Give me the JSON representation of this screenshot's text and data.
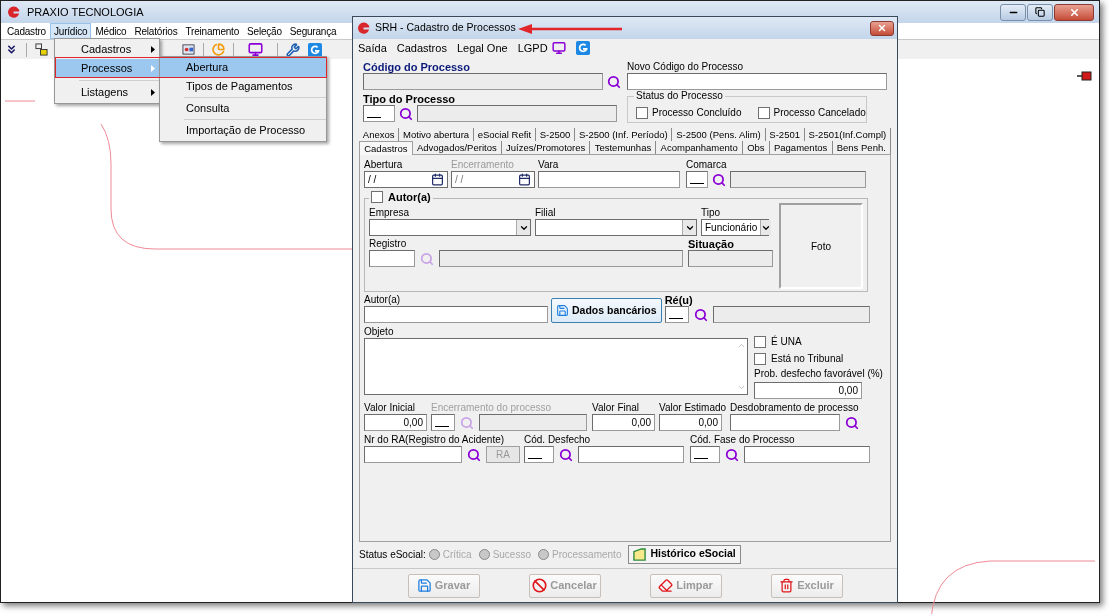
{
  "main_window": {
    "title": "PRAXIO TECNOLOGIA",
    "menu": [
      {
        "label": "Cadastro",
        "selected": false
      },
      {
        "label": "Jurídico",
        "selected": true
      },
      {
        "label": "Médico",
        "selected": false
      },
      {
        "label": "Relatórios",
        "selected": false
      },
      {
        "label": "Treinamento",
        "selected": false
      },
      {
        "label": "Seleção",
        "selected": false
      },
      {
        "label": "Segurança",
        "selected": false
      }
    ]
  },
  "dropdown_menu": {
    "items": [
      {
        "label": "Cadastros",
        "selected": false
      },
      {
        "label": "Processos",
        "selected": true
      },
      {
        "label": "Listagens",
        "selected": false
      }
    ]
  },
  "submenu": {
    "items": [
      {
        "label": "Abertura",
        "selected": true
      },
      {
        "label": "Tipos de Pagamentos",
        "selected": false
      },
      {
        "label": "Consulta",
        "selected": false
      },
      {
        "label": "Importação de Processo",
        "selected": false
      }
    ]
  },
  "dialog": {
    "title": "SRH - Cadastro de Processos",
    "menu": [
      "Saída",
      "Cadastros",
      "Legal One",
      "LGPD"
    ],
    "codigo_processo": {
      "label": "Código do Processo"
    },
    "novo_codigo": {
      "label": "Novo Código do Processo"
    },
    "tipo_processo": {
      "label": "Tipo do Processo"
    },
    "status_processo": {
      "label": "Status do Processo",
      "options": [
        {
          "label": "Processo Concluído",
          "checked": false
        },
        {
          "label": "Processo Cancelado",
          "checked": false
        }
      ]
    },
    "tabs_row_1": [
      {
        "label": "Anexos",
        "selected": false
      },
      {
        "label": "Motivo abertura",
        "selected": false
      },
      {
        "label": "eSocial Refit",
        "selected": false
      },
      {
        "label": "S-2500",
        "selected": false
      },
      {
        "label": "S-2500 (Inf. Período)",
        "selected": false
      },
      {
        "label": "S-2500 (Pens. Alim)",
        "selected": false
      },
      {
        "label": "S-2501",
        "selected": false
      },
      {
        "label": "S-2501(Inf.Compl)",
        "selected": false
      }
    ],
    "tabs_row_2": [
      {
        "label": "Cadastros",
        "selected": true
      },
      {
        "label": "Advogados/Peritos",
        "selected": false
      },
      {
        "label": "Juízes/Promotores",
        "selected": false
      },
      {
        "label": "Testemunhas",
        "selected": false
      },
      {
        "label": "Acompanhamento",
        "selected": false
      },
      {
        "label": "Obs",
        "selected": false
      },
      {
        "label": "Pagamentos",
        "selected": false
      },
      {
        "label": "Bens Penh.",
        "selected": false
      }
    ],
    "abertura": {
      "label": "Abertura",
      "value": "/ /",
      "disabled": false
    },
    "encerramento": {
      "label": "Encerramento",
      "value": "/ /",
      "disabled": true
    },
    "vara": {
      "label": "Vara"
    },
    "comarca": {
      "label": "Comarca"
    },
    "autor_group": {
      "label": "Autor(a)",
      "checked": false,
      "empresa": {
        "label": "Empresa"
      },
      "filial": {
        "label": "Filial"
      },
      "tipo": {
        "label": "Tipo",
        "value": "Funcionário"
      },
      "registro": {
        "label": "Registro",
        "lookup_disabled": true
      },
      "situacao": {
        "label": "Situação"
      },
      "foto": "Foto"
    },
    "autor": {
      "label": "Autor(a)"
    },
    "dados_bancarios_button": "Dados bancários",
    "reu": {
      "label": "Ré(u)"
    },
    "objeto": {
      "label": "Objeto"
    },
    "e_una": {
      "label": "É UNA",
      "checked": false
    },
    "esta_no_tribunal": {
      "label": "Está no Tribunal",
      "checked": false
    },
    "prob_desfecho": {
      "label": "Prob. desfecho favorável (%)",
      "value": "0,00"
    },
    "valor_inicial": {
      "label": "Valor Inicial",
      "value": "0,00"
    },
    "encerramento_processo": {
      "label": "Encerramento do processo",
      "disabled": true
    },
    "valor_final": {
      "label": "Valor Final",
      "value": "0,00"
    },
    "valor_estimado": {
      "label": "Valor Estimado",
      "value": "0,00"
    },
    "desdobramento": {
      "label": "Desdobramento de processo"
    },
    "nr_ra": {
      "label": "Nr do RA(Registro do Acidente)"
    },
    "ra_button": {
      "label": "RA",
      "disabled": true
    },
    "cod_desfecho": {
      "label": "Cód. Desfecho"
    },
    "cod_fase": {
      "label": "Cód. Fase do Processo"
    },
    "status_esocial": {
      "label": "Status eSocial:",
      "options": [
        {
          "label": "Crítica",
          "disabled": true
        },
        {
          "label": "Sucesso",
          "disabled": true
        },
        {
          "label": "Processamento",
          "disabled": true
        }
      ]
    },
    "historico_button": "Histórico eSocial",
    "buttons": [
      {
        "kind": "save",
        "label": "Gravar",
        "disabled": true
      },
      {
        "kind": "cancel",
        "label": "Cancelar",
        "disabled": true
      },
      {
        "kind": "clear",
        "label": "Limpar",
        "disabled": true
      },
      {
        "kind": "delete",
        "label": "Excluir",
        "disabled": true
      }
    ]
  }
}
